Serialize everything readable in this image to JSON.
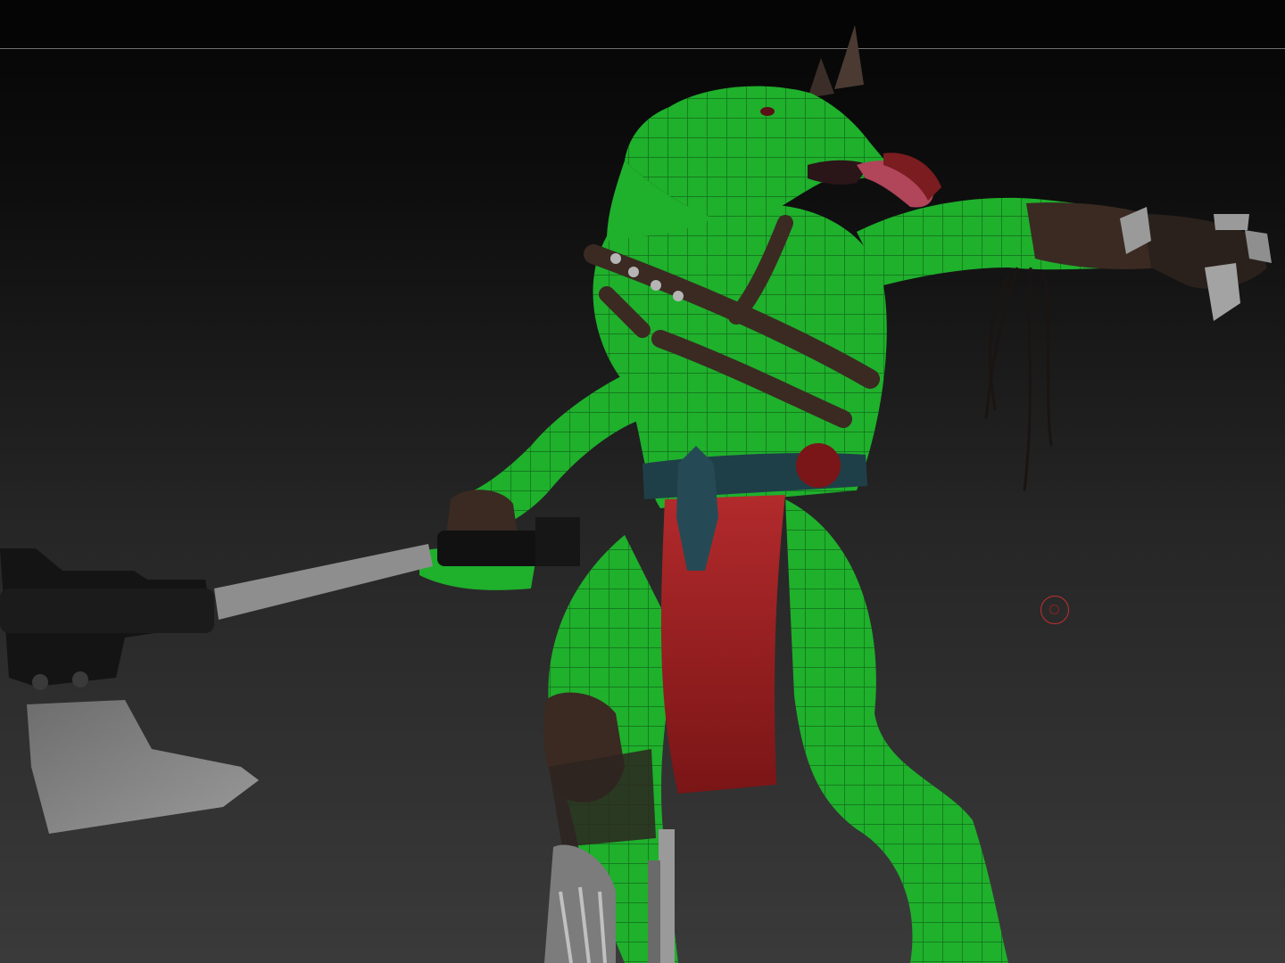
{
  "canvas": {
    "subject": "lizard-warrior-sculpt",
    "colors": {
      "skin": "#1fb02c",
      "skin_dark": "#0f6a18",
      "leather": "#3a2a22",
      "loincloth": "#a51f22",
      "metal": "#8a8a8a",
      "belt": "#1f3f48",
      "background_top": "#050505",
      "background_bottom": "#3a3a3a"
    }
  },
  "brush_cursor": {
    "icon": "brush-cursor-icon",
    "color": "#c23030"
  }
}
